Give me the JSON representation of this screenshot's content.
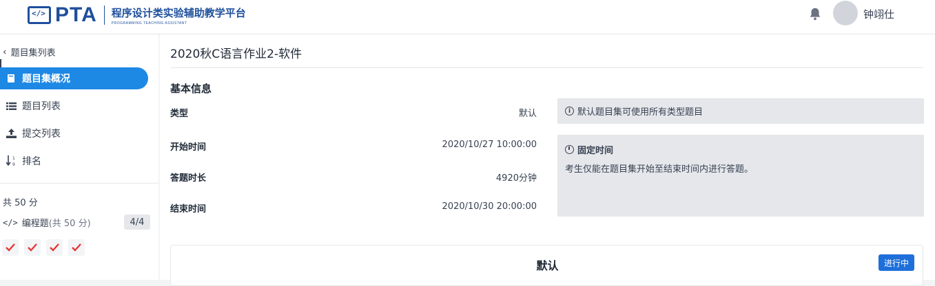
{
  "header": {
    "logo_text": "PTA",
    "logo_subtitle_cn": "程序设计类实验辅助教学平台",
    "logo_subtitle_en": "PROGRAMMING TEACHING ASSISTANT",
    "username": "钟翊仕",
    "brand_color": "#1e4f9c"
  },
  "sidebar": {
    "back_label": "题目集列表",
    "items": [
      {
        "label": "题目集概况",
        "icon": "book-icon",
        "active": true
      },
      {
        "label": "题目列表",
        "icon": "list-icon",
        "active": false
      },
      {
        "label": "提交列表",
        "icon": "upload-icon",
        "active": false
      },
      {
        "label": "排名",
        "icon": "sort-numeric-icon",
        "active": false
      }
    ],
    "total_label": "共 50 分",
    "category_label": "编程题",
    "category_points": "(共 50 分)",
    "category_count": "4/4",
    "solved_count": 4,
    "accent_color": "#1e88e5",
    "check_color": "#e53935"
  },
  "main": {
    "title": "2020秋C语言作业2-软件",
    "section_title": "基本信息",
    "rows": [
      {
        "label": "类型",
        "value": "默认"
      },
      {
        "label": "开始时间",
        "value": "2020/10/27 10:00:00"
      },
      {
        "label": "答题时长",
        "value": "4920分钟"
      },
      {
        "label": "结束时间",
        "value": "2020/10/30 20:00:00"
      }
    ],
    "type_note": "默认题目集可使用所有类型题目",
    "fixed_time_title": "固定时间",
    "fixed_time_desc": "考生仅能在题目集开始至结束时间内进行答题。",
    "card_title": "默认",
    "status_label": "进行中"
  }
}
